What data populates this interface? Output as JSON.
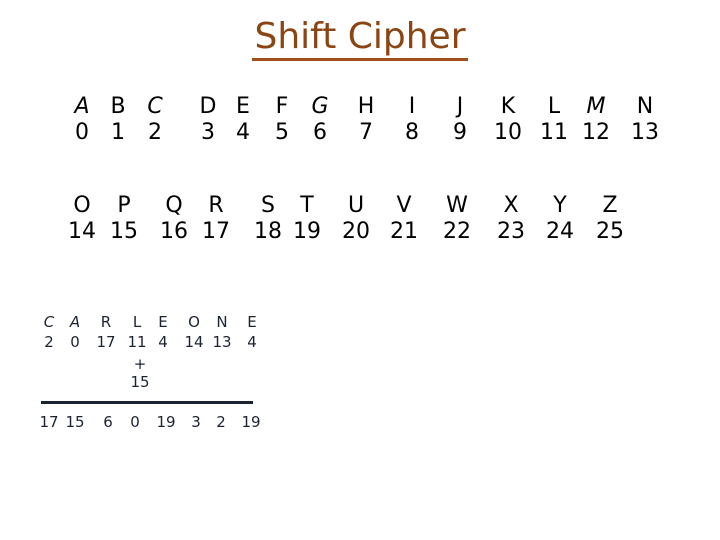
{
  "title": "Shift Cipher",
  "alphabet_rows": [
    [
      {
        "letter": "A",
        "number": "0"
      },
      {
        "letter": "B",
        "number": "1"
      },
      {
        "letter": "C",
        "number": "2"
      },
      {
        "letter": "D",
        "number": "3"
      },
      {
        "letter": "E",
        "number": "4"
      },
      {
        "letter": "F",
        "number": "5"
      },
      {
        "letter": "G",
        "number": "6"
      },
      {
        "letter": "H",
        "number": "7"
      },
      {
        "letter": "I",
        "number": "8"
      },
      {
        "letter": "J",
        "number": "9"
      },
      {
        "letter": "K",
        "number": "10"
      },
      {
        "letter": "L",
        "number": "11"
      },
      {
        "letter": "M",
        "number": "12"
      },
      {
        "letter": "N",
        "number": "13"
      }
    ],
    [
      {
        "letter": "O",
        "number": "14"
      },
      {
        "letter": "P",
        "number": "15"
      },
      {
        "letter": "Q",
        "number": "16"
      },
      {
        "letter": "R",
        "number": "17"
      },
      {
        "letter": "S",
        "number": "18"
      },
      {
        "letter": "T",
        "number": "19"
      },
      {
        "letter": "U",
        "number": "20"
      },
      {
        "letter": "V",
        "number": "21"
      },
      {
        "letter": "W",
        "number": "22"
      },
      {
        "letter": "X",
        "number": "23"
      },
      {
        "letter": "Y",
        "number": "24"
      },
      {
        "letter": "Z",
        "number": "25"
      }
    ]
  ],
  "example": {
    "plaintext": [
      {
        "letter": "C",
        "number": "2"
      },
      {
        "letter": "A",
        "number": "0"
      },
      {
        "letter": "R",
        "number": "17"
      },
      {
        "letter": "L",
        "number": "11"
      },
      {
        "letter": "E",
        "number": "4"
      },
      {
        "letter": "O",
        "number": "14"
      },
      {
        "letter": "N",
        "number": "13"
      },
      {
        "letter": "E",
        "number": "4"
      }
    ],
    "operator": "+",
    "shift": "15",
    "result": [
      "17",
      "15",
      "6",
      "0",
      "19",
      "3",
      "2",
      "19"
    ]
  },
  "colors": {
    "title": "#8b4513",
    "text": "#000000",
    "example_text": "#1b2333"
  }
}
